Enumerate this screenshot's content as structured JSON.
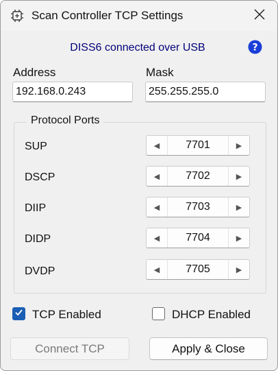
{
  "window": {
    "title": "Scan Controller TCP Settings"
  },
  "status": {
    "text": "DISS6 connected over USB"
  },
  "address": {
    "label": "Address",
    "value": "192.168.0.243"
  },
  "mask": {
    "label": "Mask",
    "value": "255.255.255.0"
  },
  "protocol_ports": {
    "title": "Protocol Ports",
    "ports": [
      {
        "label": "SUP",
        "value": "7701"
      },
      {
        "label": "DSCP",
        "value": "7702"
      },
      {
        "label": "DIIP",
        "value": "7703"
      },
      {
        "label": "DIDP",
        "value": "7704"
      },
      {
        "label": "DVDP",
        "value": "7705"
      }
    ]
  },
  "options": {
    "tcp_enabled": {
      "label": "TCP Enabled",
      "checked": true
    },
    "dhcp_enabled": {
      "label": "DHCP Enabled",
      "checked": false
    }
  },
  "buttons": {
    "connect_tcp": "Connect TCP",
    "apply_close": "Apply & Close"
  },
  "icons": {
    "app": "scan-controller-icon",
    "close": "close-icon",
    "help": "help-icon",
    "decrement": "left-arrow-icon",
    "increment": "right-arrow-icon",
    "check": "checkmark-icon"
  },
  "colors": {
    "accent": "#1a5fb4",
    "status_text": "#00007a",
    "help_blue": "#1a3fd8"
  }
}
